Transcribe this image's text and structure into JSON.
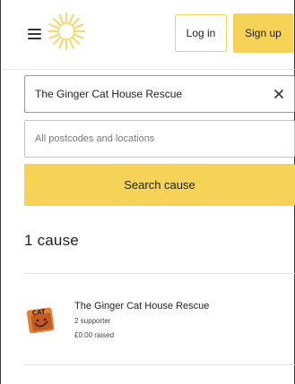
{
  "header": {
    "menu_icon": "hamburger-menu-icon",
    "logo_icon": "sunburst-logo-icon",
    "login_label": "Log in",
    "signup_label": "Sign up"
  },
  "search": {
    "query_value": "The Ginger Cat House Rescue",
    "clear_icon": "close-icon",
    "location_placeholder": "All postcodes and locations",
    "button_label": "Search cause"
  },
  "results": {
    "count_label": "1 cause",
    "items": [
      {
        "name": "The Ginger Cat House Rescue",
        "supporters": "2 supporter",
        "raised": "£0.00 raised",
        "thumb_text": "CAT"
      }
    ]
  },
  "colors": {
    "accent": "#f6d357",
    "logo": "#f3d873",
    "border": "#9a9a9a"
  }
}
